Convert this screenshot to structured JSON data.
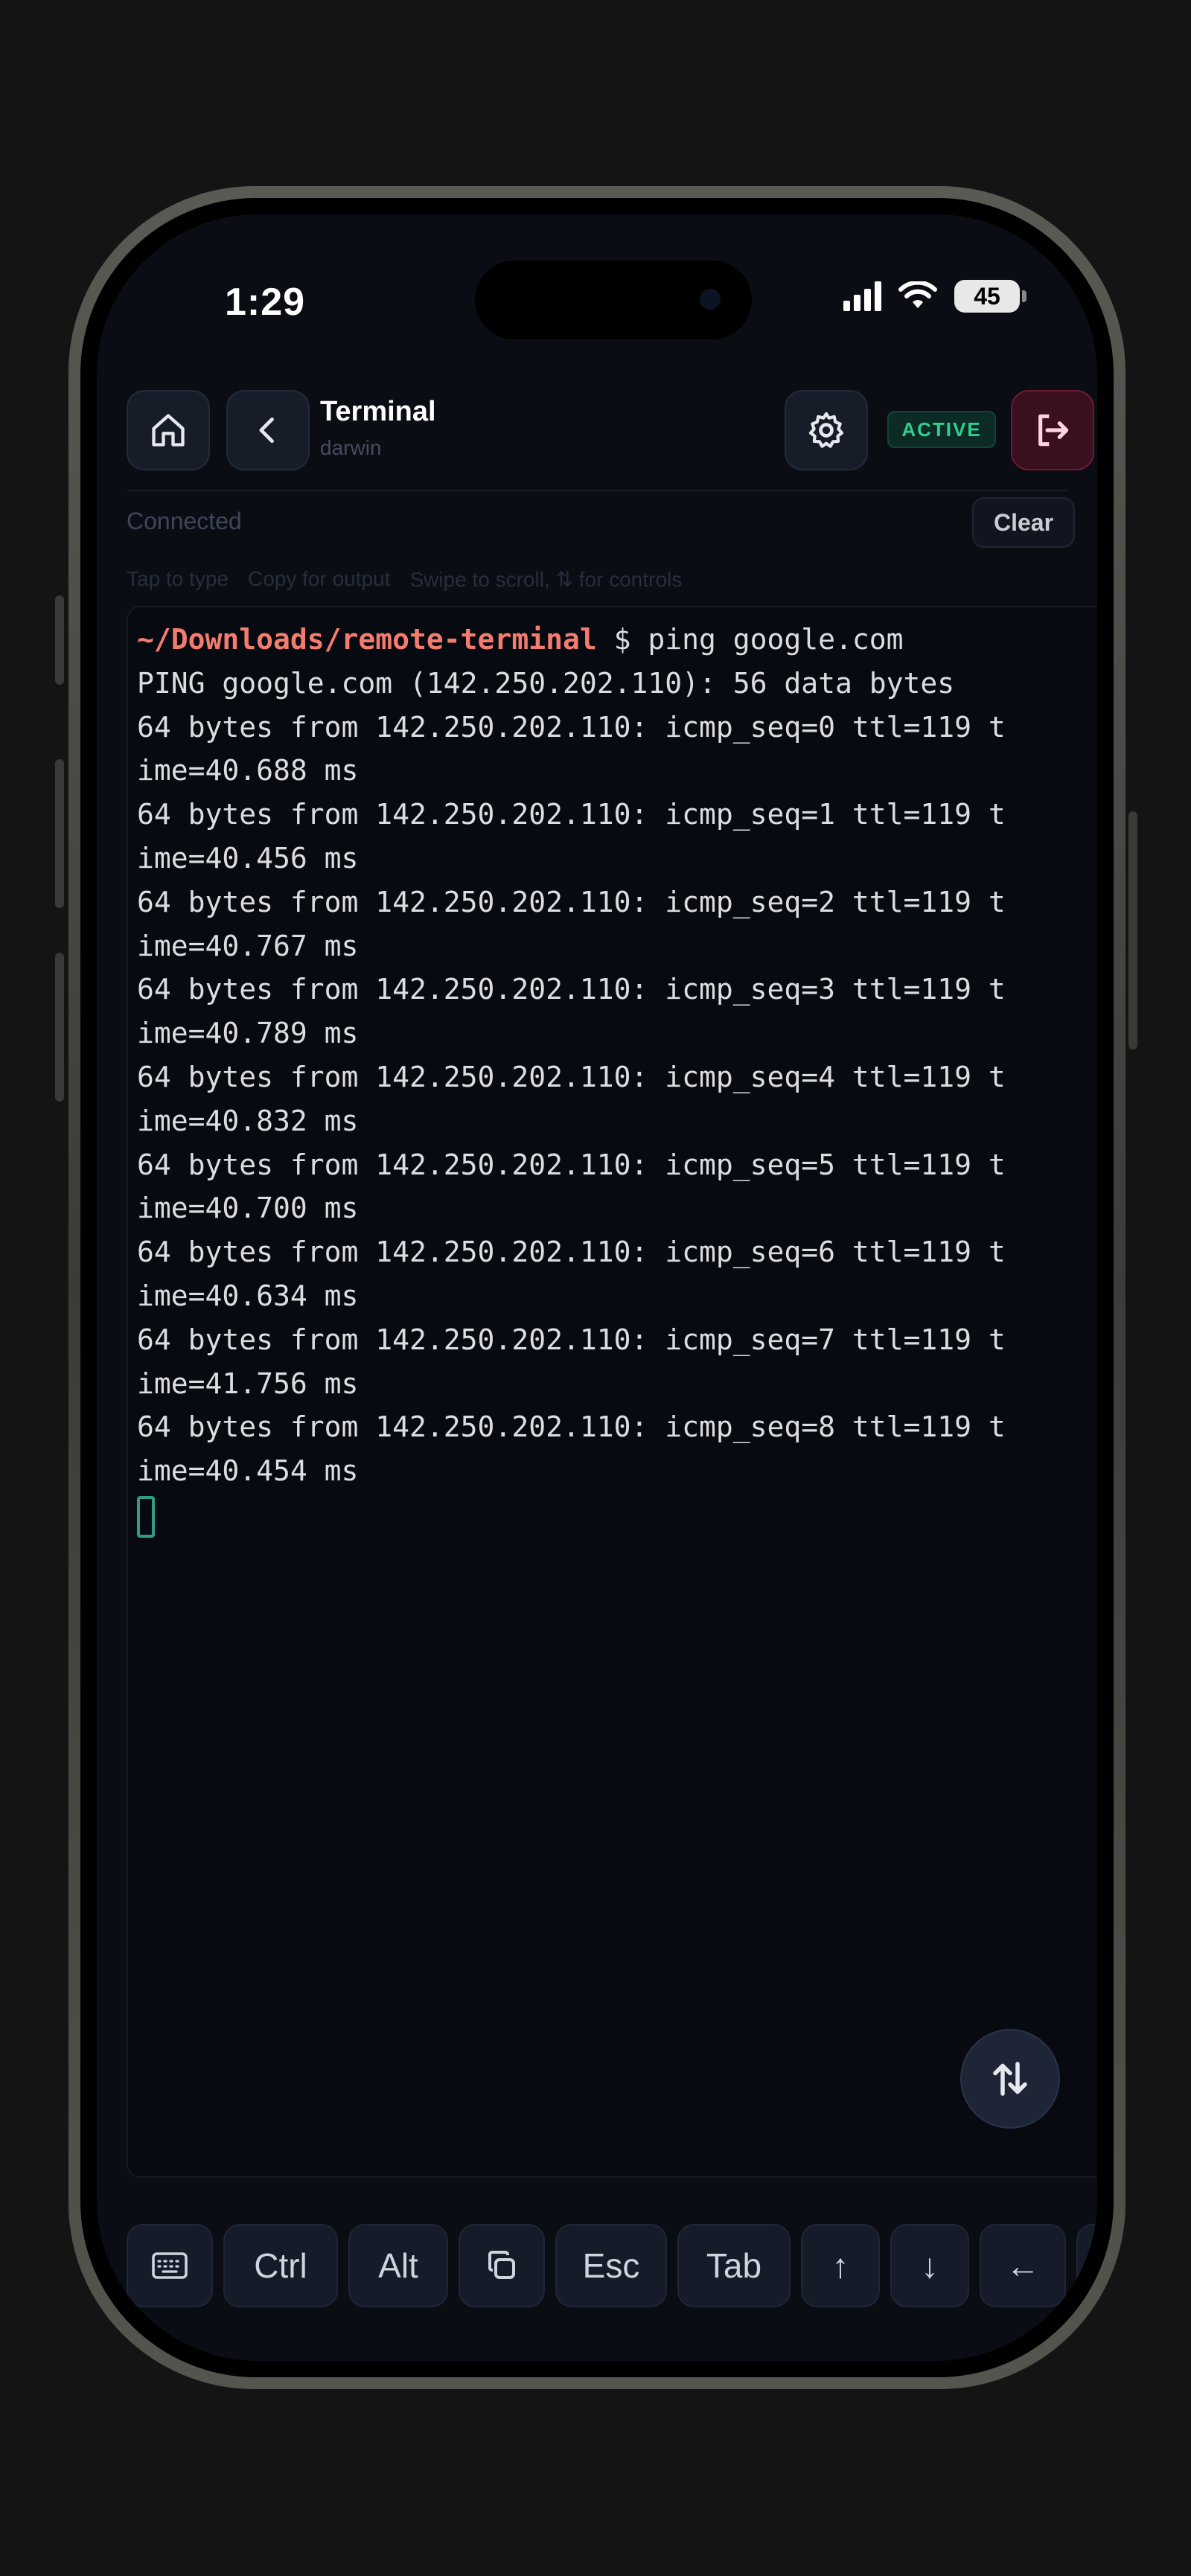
{
  "status_bar": {
    "time": "1:29",
    "battery": "45",
    "icons": [
      "signal-icon",
      "wifi-icon",
      "battery-icon"
    ]
  },
  "header": {
    "title": "Terminal",
    "subtitle": "darwin",
    "status_badge": "ACTIVE",
    "icons": [
      "home-icon",
      "chevron-left-icon",
      "gear-icon",
      "exit-icon"
    ],
    "colors": {
      "active": "#2ecf93",
      "exit": "#e64b76"
    }
  },
  "connection": {
    "status": "Connected",
    "clear_label": "Clear"
  },
  "hints": [
    "Tap to type",
    "Copy for output",
    "Swipe to scroll, ⇅ for controls"
  ],
  "terminal": {
    "prompt_path": "~/Downloads/remote-terminal",
    "prompt_symbol": " $ ",
    "command": "ping google.com",
    "lines": [
      "PING google.com (142.250.202.110): 56 data bytes",
      "64 bytes from 142.250.202.110: icmp_seq=0 ttl=119 t",
      "ime=40.688 ms",
      "64 bytes from 142.250.202.110: icmp_seq=1 ttl=119 t",
      "ime=40.456 ms",
      "64 bytes from 142.250.202.110: icmp_seq=2 ttl=119 t",
      "ime=40.767 ms",
      "64 bytes from 142.250.202.110: icmp_seq=3 ttl=119 t",
      "ime=40.789 ms",
      "64 bytes from 142.250.202.110: icmp_seq=4 ttl=119 t",
      "ime=40.832 ms",
      "64 bytes from 142.250.202.110: icmp_seq=5 ttl=119 t",
      "ime=40.700 ms",
      "64 bytes from 142.250.202.110: icmp_seq=6 ttl=119 t",
      "ime=40.634 ms",
      "64 bytes from 142.250.202.110: icmp_seq=7 ttl=119 t",
      "ime=41.756 ms",
      "64 bytes from 142.250.202.110: icmp_seq=8 ttl=119 t",
      "ime=40.454 ms"
    ],
    "colors": {
      "prompt": "#f47c6f",
      "cursor": "#2f9c8a"
    }
  },
  "keybar": {
    "keyboard_icon": "keyboard-icon",
    "ctrl": "Ctrl",
    "alt": "Alt",
    "copy_icon": "copy-icon",
    "esc": "Esc",
    "tab": "Tab",
    "up": "↑",
    "down": "↓",
    "left": "←",
    "right": "→"
  },
  "fab_icon": "swap-vertical-icon"
}
